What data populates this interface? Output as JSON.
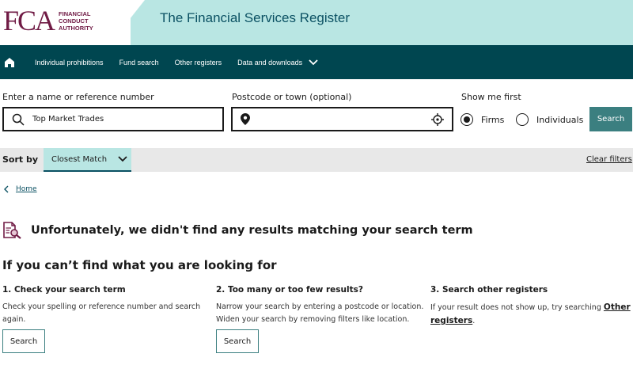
{
  "header": {
    "logo_letters": "FCA",
    "logo_line1": "FINANCIAL",
    "logo_line2": "CONDUCT",
    "logo_line3": "AUTHORITY",
    "title": "The Financial Services Register"
  },
  "nav": {
    "home_icon": "home-icon",
    "items": [
      {
        "label": "Individual prohibitions"
      },
      {
        "label": "Fund search"
      },
      {
        "label": "Other registers"
      },
      {
        "label": "Data and downloads"
      }
    ]
  },
  "search": {
    "name_label": "Enter a name or reference number",
    "name_value": "Top Market Trades",
    "postcode_label": "Postcode or town (optional)",
    "postcode_value": "",
    "show_first_label": "Show me first",
    "options": [
      {
        "label": "Firms",
        "checked": true
      },
      {
        "label": "Individuals",
        "checked": false
      }
    ],
    "button_label": "Search"
  },
  "sort": {
    "label": "Sort by",
    "selected": "Closest Match",
    "clear_filters": "Clear filters"
  },
  "breadcrumb": {
    "home": "Home"
  },
  "results": {
    "no_results_message": "Unfortunately, we didn't find any results matching your search term"
  },
  "help": {
    "title": "If you can’t find what you are looking for",
    "columns": [
      {
        "title": "1. Check your search term",
        "text_line1": "Check your spelling or reference number and search",
        "text_line2": "again.",
        "button": "Search"
      },
      {
        "title": "2. Too many or too few results?",
        "text_line1": "Narrow your search by entering a postcode or location.",
        "text_line2": "Widen your search by removing filters like location.",
        "button": "Search"
      },
      {
        "title": "3. Search other registers",
        "text_prefix": "If your result does not show up, try searching",
        "link_part1": "Other",
        "link_part2": "registers",
        "text_suffix": "."
      }
    ]
  },
  "colors": {
    "brand": "#701b45",
    "nav_bg": "#004650",
    "header_band": "#b9e6e3",
    "accent": "#3b7f80"
  }
}
